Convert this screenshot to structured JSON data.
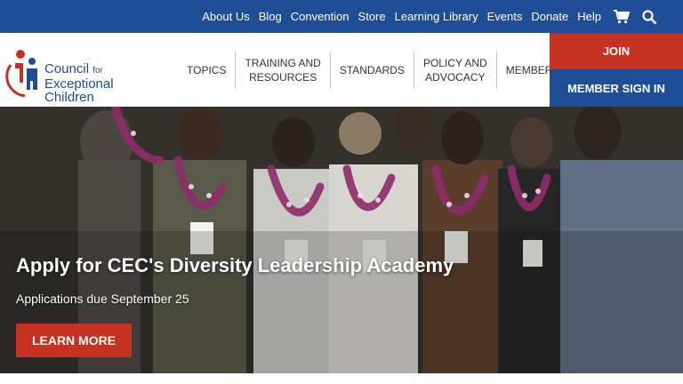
{
  "utility_nav": {
    "items": [
      "About Us",
      "Blog",
      "Convention",
      "Store",
      "Learning Library",
      "Events",
      "Donate",
      "Help"
    ],
    "cart_icon": "cart-icon",
    "search_icon": "search-icon"
  },
  "logo": {
    "line1": "Council",
    "line1_small": "for",
    "line2": "Exceptional",
    "line3": "Children",
    "mark_icon": "cec-figure-logo"
  },
  "main_nav": {
    "items": [
      "TOPICS",
      "TRAINING AND\nRESOURCES",
      "STANDARDS",
      "POLICY AND\nADVOCACY",
      "MEMBERSHIP"
    ]
  },
  "cta": {
    "join": "JOIN",
    "signin": "MEMBER SIGN IN"
  },
  "hero": {
    "title": "Apply for CEC's Diversity Leadership Academy",
    "subtitle": "Applications due September 25",
    "button": "LEARN MORE"
  },
  "colors": {
    "primary_blue": "#1f4e96",
    "accent_red": "#c53222"
  }
}
